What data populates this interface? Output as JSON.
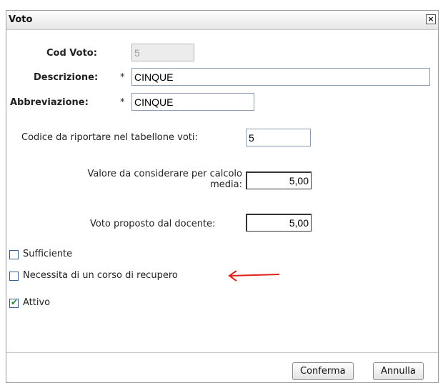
{
  "dialog": {
    "title": "Voto",
    "close_symbol": "×"
  },
  "form": {
    "cod_voto_label": "Cod Voto:",
    "cod_voto_value": "5",
    "descrizione_label": "Descrizione:",
    "descrizione_value": "CINQUE",
    "abbreviazione_label": "Abbreviazione:",
    "abbreviazione_value": "CINQUE",
    "required_marker": "*",
    "codice_tabellone_label": "Codice da riportare nel tabellone voti:",
    "codice_tabellone_value": "5",
    "valore_media_label_1": "Valore da considerare per calcolo",
    "valore_media_label_2": "media:",
    "valore_media_value": "5,00",
    "voto_proposto_label": "Voto proposto dal docente:",
    "voto_proposto_value": "5,00"
  },
  "checkboxes": [
    {
      "label": "Sufficiente",
      "checked": false
    },
    {
      "label": "Necessita di un corso di recupero",
      "checked": false
    },
    {
      "label": "Attivo",
      "checked": true
    }
  ],
  "annotation": {
    "arrow_color": "#e0201a"
  },
  "buttons": {
    "confirm_label": "Conferma",
    "cancel_label": "Annulla"
  },
  "icons": {
    "close": "close-icon",
    "check": "checkmark-icon",
    "arrow": "left-arrow-icon"
  }
}
